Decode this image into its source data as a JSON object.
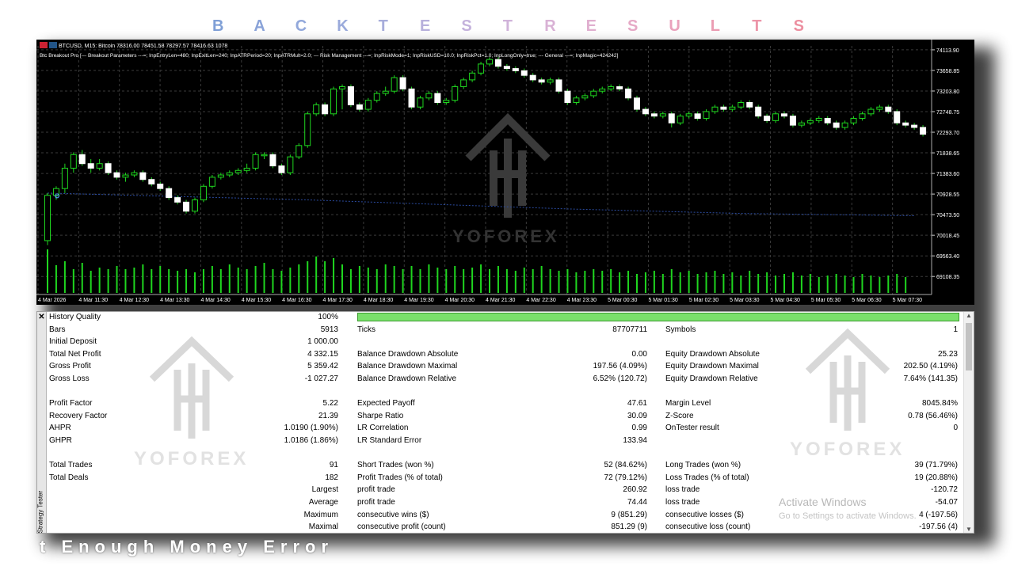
{
  "banner": {
    "letters": [
      "B",
      "A",
      "C",
      "K",
      "T",
      "E",
      "S",
      "T",
      "R",
      "E",
      "S",
      "U",
      "L",
      "T",
      "S"
    ],
    "colors": [
      "#7f9fd6",
      "#8aa3d8",
      "#92a8db",
      "#9aaadb",
      "#a7addb",
      "#b7b0dc",
      "#c4b2dc",
      "#d0b3da",
      "#d9b2d5",
      "#e0afcf",
      "#e6a9c6",
      "#eaa2bc",
      "#eb9cb2",
      "#ec95a8",
      "#ec8fa0"
    ]
  },
  "chart": {
    "symbol_line": "BTCUSD, M15:  Bitcoin  78316.00 78451.58 78297.57 78416.63  1078",
    "params_line": "Btc Breakout Pro [--- Breakout Parameters ---=; InpEntryLen=480; InpExitLen=240; InpATRPeriod=20; InpATRMult=2.0; --- Risk Management ---=; InpRiskMode=1; InpRiskUSD=10.0; InpRiskPct=1.0; InpLongOnly=true; --- General ---=; InpMagic=424242]",
    "price_ticks": [
      "74113.90",
      "73658.85",
      "73203.80",
      "72748.75",
      "72293.70",
      "71838.65",
      "71383.60",
      "70928.55",
      "70473.50",
      "70018.45",
      "69563.40",
      "69108.35"
    ],
    "time_ticks": [
      "4 Mar 2026",
      "4 Mar 11:30",
      "4 Mar 12:30",
      "4 Mar 13:30",
      "4 Mar 14:30",
      "4 Mar 15:30",
      "4 Mar 16:30",
      "4 Mar 17:30",
      "4 Mar 18:30",
      "4 Mar 19:30",
      "4 Mar 20:30",
      "4 Mar 21:30",
      "4 Mar 22:30",
      "4 Mar 23:30",
      "5 Mar 00:30",
      "5 Mar 01:30",
      "5 Mar 02:30",
      "5 Mar 03:30",
      "5 Mar 04:30",
      "5 Mar 05:30",
      "5 Mar 06:30",
      "5 Mar 07:30"
    ],
    "watermark": "YOFOREX"
  },
  "chart_data": {
    "type": "candlestick",
    "price_axis_range": [
      68850,
      74200
    ],
    "candles": [
      [
        69900,
        70900,
        69800,
        70950
      ],
      [
        70900,
        71050,
        70800,
        71100
      ],
      [
        71050,
        71500,
        70950,
        71600
      ],
      [
        71500,
        71800,
        71400,
        71850
      ],
      [
        71800,
        71600,
        71550,
        71900
      ],
      [
        71600,
        71500,
        71400,
        71700
      ],
      [
        71500,
        71600,
        71450,
        71700
      ],
      [
        71600,
        71400,
        71350,
        71650
      ],
      [
        71400,
        71300,
        71250,
        71450
      ],
      [
        71300,
        71350,
        71200,
        71400
      ],
      [
        71350,
        71400,
        71300,
        71450
      ],
      [
        71400,
        71250,
        71200,
        71450
      ],
      [
        71250,
        71150,
        71100,
        71300
      ],
      [
        71150,
        71050,
        71000,
        71200
      ],
      [
        71050,
        70850,
        70800,
        71100
      ],
      [
        70850,
        70750,
        70700,
        70900
      ],
      [
        70750,
        70550,
        70500,
        70800
      ],
      [
        70550,
        70800,
        70500,
        70850
      ],
      [
        70800,
        71100,
        70750,
        71150
      ],
      [
        71100,
        71300,
        71050,
        71350
      ],
      [
        71300,
        71350,
        71250,
        71400
      ],
      [
        71350,
        71400,
        71300,
        71450
      ],
      [
        71400,
        71450,
        71350,
        71500
      ],
      [
        71450,
        71500,
        71400,
        71600
      ],
      [
        71500,
        71800,
        71450,
        71850
      ],
      [
        71800,
        71800,
        71700,
        71850
      ],
      [
        71800,
        71550,
        71500,
        71850
      ],
      [
        71550,
        71400,
        71350,
        71600
      ],
      [
        71400,
        71750,
        71350,
        71800
      ],
      [
        71750,
        72000,
        71700,
        72050
      ],
      [
        72000,
        72700,
        71950,
        72750
      ],
      [
        72700,
        72900,
        72650,
        72950
      ],
      [
        72900,
        72700,
        72650,
        72950
      ],
      [
        72700,
        73250,
        72650,
        73300
      ],
      [
        73250,
        73300,
        72800,
        73350
      ],
      [
        73300,
        72900,
        72850,
        73350
      ],
      [
        72900,
        72800,
        72750,
        72950
      ],
      [
        72800,
        73000,
        72750,
        73050
      ],
      [
        73000,
        73150,
        72950,
        73200
      ],
      [
        73150,
        73200,
        73100,
        73300
      ],
      [
        73200,
        73500,
        73150,
        73550
      ],
      [
        73500,
        73250,
        73200,
        73550
      ],
      [
        73250,
        72850,
        72800,
        73300
      ],
      [
        72850,
        73050,
        72800,
        73100
      ],
      [
        73050,
        73150,
        73000,
        73200
      ],
      [
        73150,
        72950,
        72900,
        73200
      ],
      [
        72950,
        73000,
        72900,
        73050
      ],
      [
        73000,
        73300,
        72950,
        73350
      ],
      [
        73300,
        73450,
        73250,
        73500
      ],
      [
        73450,
        73600,
        73400,
        73650
      ],
      [
        73600,
        73800,
        73550,
        73850
      ],
      [
        73800,
        73900,
        73750,
        73950
      ],
      [
        73900,
        73750,
        73700,
        73950
      ],
      [
        73750,
        73700,
        73650,
        73800
      ],
      [
        73700,
        73650,
        73600,
        73750
      ],
      [
        73650,
        73550,
        73500,
        73700
      ],
      [
        73550,
        73450,
        73400,
        73600
      ],
      [
        73450,
        73400,
        73350,
        73500
      ],
      [
        73400,
        73450,
        73350,
        73500
      ],
      [
        73450,
        73200,
        73150,
        73500
      ],
      [
        73200,
        72950,
        72900,
        73250
      ],
      [
        72950,
        73050,
        72900,
        73100
      ],
      [
        73050,
        73100,
        73000,
        73150
      ],
      [
        73100,
        73200,
        73050,
        73250
      ],
      [
        73200,
        73250,
        73150,
        73300
      ],
      [
        73250,
        73300,
        73200,
        73350
      ],
      [
        73300,
        73250,
        73200,
        73350
      ],
      [
        73250,
        73050,
        73000,
        73300
      ],
      [
        73050,
        72800,
        72750,
        73100
      ],
      [
        72800,
        72700,
        72650,
        72850
      ],
      [
        72700,
        72650,
        72600,
        72750
      ],
      [
        72650,
        72700,
        72600,
        72750
      ],
      [
        72700,
        72500,
        72400,
        72750
      ],
      [
        72500,
        72650,
        72450,
        72700
      ],
      [
        72650,
        72700,
        72600,
        72750
      ],
      [
        72700,
        72600,
        72550,
        72750
      ],
      [
        72600,
        72750,
        72550,
        72800
      ],
      [
        72750,
        72850,
        72700,
        72900
      ],
      [
        72850,
        72800,
        72750,
        72900
      ],
      [
        72800,
        72850,
        72750,
        72900
      ],
      [
        72850,
        72950,
        72800,
        73000
      ],
      [
        72950,
        72850,
        72800,
        73000
      ],
      [
        72850,
        72650,
        72600,
        72900
      ],
      [
        72650,
        72550,
        72500,
        72700
      ],
      [
        72550,
        72700,
        72500,
        72750
      ],
      [
        72700,
        72650,
        72600,
        72750
      ],
      [
        72650,
        72450,
        72400,
        72700
      ],
      [
        72450,
        72500,
        72400,
        72550
      ],
      [
        72500,
        72550,
        72450,
        72600
      ],
      [
        72550,
        72600,
        72500,
        72650
      ],
      [
        72600,
        72500,
        72450,
        72650
      ],
      [
        72500,
        72400,
        72350,
        72550
      ],
      [
        72400,
        72500,
        72350,
        72550
      ],
      [
        72500,
        72600,
        72450,
        72650
      ],
      [
        72600,
        72700,
        72550,
        72750
      ],
      [
        72700,
        72800,
        72650,
        72850
      ],
      [
        72800,
        72850,
        72750,
        72900
      ],
      [
        72850,
        72750,
        72700,
        72900
      ],
      [
        72750,
        72500,
        72450,
        72800
      ],
      [
        72500,
        72450,
        72400,
        72550
      ],
      [
        72450,
        72400,
        72350,
        72500
      ],
      [
        72400,
        72250,
        72200,
        72450
      ]
    ],
    "ma_line": [
      [
        0,
        70950
      ],
      [
        30,
        70800
      ],
      [
        60,
        70600
      ],
      [
        80,
        70500
      ],
      [
        100,
        70450
      ]
    ],
    "volume": [
      55,
      35,
      40,
      30,
      38,
      28,
      32,
      30,
      34,
      30,
      32,
      36,
      30,
      34,
      30,
      28,
      30,
      26,
      30,
      34,
      30,
      36,
      32,
      30,
      34,
      38,
      30,
      28,
      32,
      36,
      40,
      46,
      40,
      44,
      36,
      30,
      34,
      32,
      30,
      36,
      34,
      30,
      34,
      30,
      36,
      32,
      30,
      34,
      30,
      32,
      36,
      30,
      34,
      30,
      28,
      32,
      30,
      34,
      30,
      28,
      30,
      26,
      28,
      30,
      28,
      30,
      26,
      28,
      24,
      26,
      28,
      24,
      30,
      26,
      28,
      24,
      26,
      28,
      24,
      26,
      22,
      28,
      24,
      26,
      22,
      24,
      26,
      22,
      24,
      20,
      22,
      24,
      22,
      20,
      24,
      22,
      20,
      22,
      24,
      20
    ]
  },
  "tester": {
    "side_label": "Strategy Tester",
    "watermark": "YOFOREX",
    "rows": [
      [
        "History Quality",
        "100%",
        "",
        "",
        "",
        ""
      ],
      [
        "Bars",
        "5913",
        "Ticks",
        "87707711",
        "Symbols",
        "1"
      ],
      [
        "Initial Deposit",
        "1 000.00",
        "",
        "",
        "",
        ""
      ],
      [
        "Total Net Profit",
        "4 332.15",
        "Balance Drawdown Absolute",
        "0.00",
        "Equity Drawdown Absolute",
        "25.23"
      ],
      [
        "Gross Profit",
        "5 359.42",
        "Balance Drawdown Maximal",
        "197.56 (4.09%)",
        "Equity Drawdown Maximal",
        "202.50 (4.19%)"
      ],
      [
        "Gross Loss",
        "-1 027.27",
        "Balance Drawdown Relative",
        "6.52% (120.72)",
        "Equity Drawdown Relative",
        "7.64% (141.35)"
      ],
      [
        "",
        "",
        "",
        "",
        "",
        ""
      ],
      [
        "Profit Factor",
        "5.22",
        "Expected Payoff",
        "47.61",
        "Margin Level",
        "8045.84%"
      ],
      [
        "Recovery Factor",
        "21.39",
        "Sharpe Ratio",
        "30.09",
        "Z-Score",
        "0.78 (56.46%)"
      ],
      [
        "AHPR",
        "1.0190 (1.90%)",
        "LR Correlation",
        "0.99",
        "OnTester result",
        "0"
      ],
      [
        "GHPR",
        "1.0186 (1.86%)",
        "LR Standard Error",
        "133.94",
        "",
        ""
      ],
      [
        "",
        "",
        "",
        "",
        "",
        ""
      ],
      [
        "Total Trades",
        "91",
        "Short Trades (won %)",
        "52 (84.62%)",
        "Long Trades (won %)",
        "39 (71.79%)"
      ],
      [
        "Total Deals",
        "182",
        "Profit Trades (% of total)",
        "72 (79.12%)",
        "Loss Trades (% of total)",
        "19 (20.88%)"
      ],
      [
        "",
        "Largest",
        "profit trade",
        "260.92",
        "loss trade",
        "-120.72"
      ],
      [
        "",
        "Average",
        "profit trade",
        "74.44",
        "loss trade",
        "-54.07"
      ],
      [
        "",
        "Maximum",
        "consecutive wins ($)",
        "9 (851.29)",
        "consecutive losses ($)",
        "4 (-197.56)"
      ],
      [
        "",
        "Maximal",
        "consecutive profit (count)",
        "851.29 (9)",
        "consecutive loss (count)",
        "-197.56 (4)"
      ]
    ]
  },
  "overlay": {
    "activate_title": "Activate Windows",
    "activate_sub": "Go to Settings to activate Windows.",
    "footer_text": "t Enough Money Error"
  }
}
